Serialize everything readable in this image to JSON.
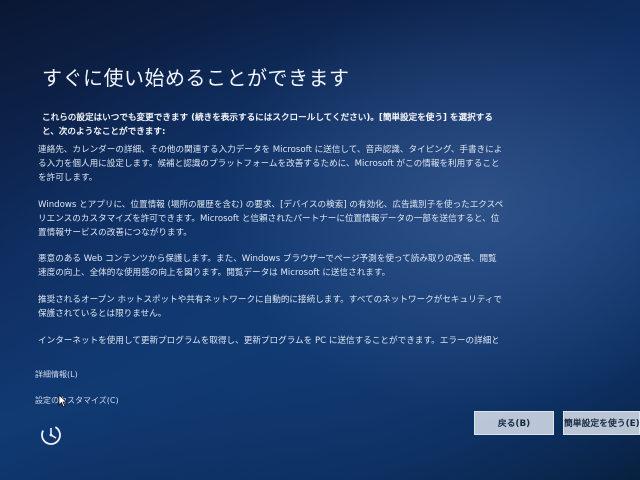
{
  "title": "すぐに使い始めることができます",
  "intro": "これらの設定はいつでも変更できます (続きを表示するにはスクロールしてください)。[簡単設定を使う] を選択すると、次のようなことができます:",
  "paragraphs": [
    "連絡先、カレンダーの詳細、その他の関連する入力データを Microsoft に送信して、音声認識、タイピング、手書きによる入力を個人用に設定します。候補と認識のプラットフォームを改善するために、Microsoft がこの情報を利用することを許可します。",
    "Windows とアプリに、位置情報 (場所の履歴を含む) の要求、[デバイスの検索] の有効化、広告識別子を使ったエクスペリエンスのカスタマイズを許可できます。Microsoft と信頼されたパートナーに位置情報データの一部を送信すると、位置情報サービスの改善につながります。",
    "悪意のある Web コンテンツから保護します。また、Windows ブラウザーでページ予測を使って読み取りの改善、閲覧速度の向上、全体的な使用感の向上を図ります。閲覧データは Microsoft に送信されます。",
    "推奨されるオープン ホットスポットや共有ネットワークに自動的に接続します。すべてのネットワークがセキュリティで保護されているとは限りません。",
    "インターネットを使用して更新プログラムを取得し、更新プログラムを PC に送信することができます。エラーの詳細と診"
  ],
  "links": {
    "details": "詳細情報(L)",
    "customize": "設定のカスタマイズ(C)"
  },
  "buttons": {
    "back": "戻る(B)",
    "express": "簡単設定を使う(E)"
  },
  "icons": {
    "ease_of_access": "ease-of-access-icon",
    "cursor": "mouse-cursor-icon"
  },
  "colors": {
    "background": "#0f2c5e",
    "text": "#e8edf6",
    "button": "#e1e8f2"
  }
}
